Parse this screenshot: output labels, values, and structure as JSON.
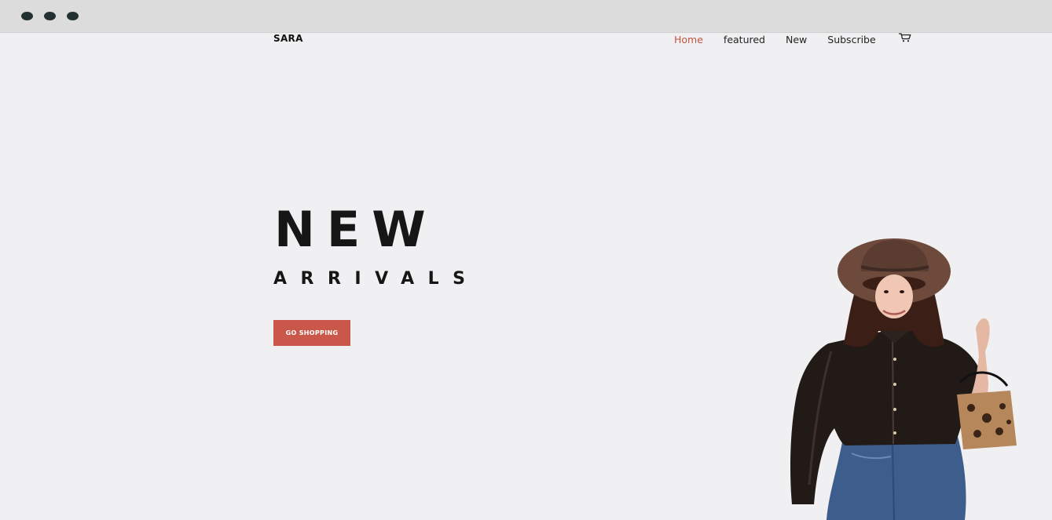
{
  "window": {
    "controls": [
      "dot",
      "dot",
      "dot"
    ]
  },
  "header": {
    "brand": "SARA",
    "nav": [
      {
        "label": "Home",
        "active": true
      },
      {
        "label": "featured",
        "active": false
      },
      {
        "label": "New",
        "active": false
      },
      {
        "label": "Subscribe",
        "active": false
      }
    ],
    "cart_icon": "shopping-cart-icon"
  },
  "hero": {
    "title": "NEW",
    "subtitle": "ARRIVALS",
    "button_label": "GO SHOPPING",
    "image": "woman-in-hat-and-leather-jacket"
  },
  "colors": {
    "accent": "#c9574a",
    "nav_active": "#c0533f",
    "background": "#f0f0f2",
    "titlebar": "#dcdcdc",
    "text": "#161616"
  }
}
